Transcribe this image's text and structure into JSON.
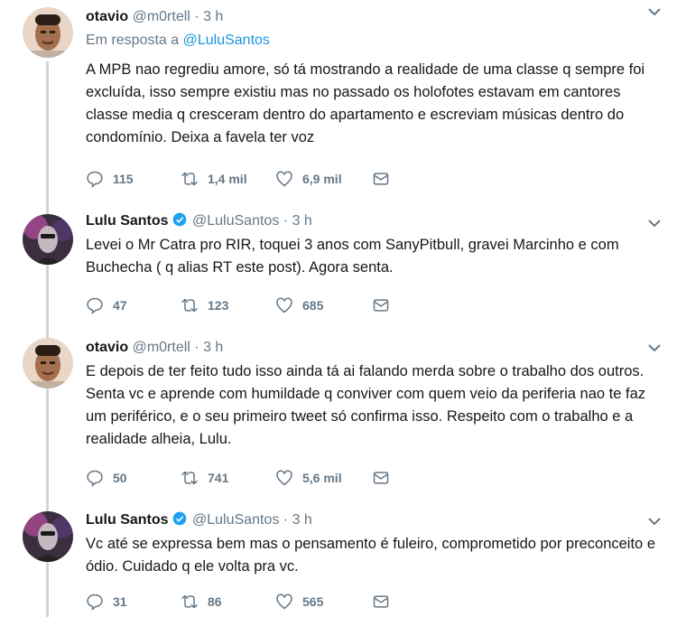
{
  "tweets": [
    {
      "name": "otavio",
      "handle": "@m0rtell",
      "time": "3 h",
      "verified": false,
      "avatar": "avatar-otavio",
      "reply_prefix": "Em resposta a ",
      "reply_mention": "@LuluSantos",
      "text": "A MPB nao regrediu amore, só tá mostrando a realidade de uma classe q sempre foi excluída, isso sempre existiu mas no passado os holofotes estavam em cantores classe media q cresceram dentro do apartamento e escreviam músicas dentro do condomínio. Deixa a favela ter voz",
      "replies": "115",
      "retweets": "1,4 mil",
      "likes": "6,9 mil"
    },
    {
      "name": "Lulu Santos",
      "handle": "@LuluSantos",
      "time": "3 h",
      "verified": true,
      "avatar": "avatar-lulu",
      "text": "Levei o Mr Catra pro RIR, toquei 3 anos com SanyPitbull, gravei Marcinho e com Buchecha ( q alias RT este post). Agora senta.",
      "replies": "47",
      "retweets": "123",
      "likes": "685"
    },
    {
      "name": "otavio",
      "handle": "@m0rtell",
      "time": "3 h",
      "verified": false,
      "avatar": "avatar-otavio",
      "text": "E depois de ter feito tudo isso ainda tá ai falando merda sobre o trabalho dos outros. Senta vc e aprende com humildade q conviver com quem veio da periferia nao te faz um periférico, e o seu primeiro tweet só confirma isso. Respeito com o trabalho e a realidade alheia, Lulu.",
      "replies": "50",
      "retweets": "741",
      "likes": "5,6 mil"
    },
    {
      "name": "Lulu Santos",
      "handle": "@LuluSantos",
      "time": "3 h",
      "verified": true,
      "avatar": "avatar-lulu",
      "text": "Vc até se expressa bem mas o pensamento é fuleiro, comprometido por preconceito e ódio. Cuidado q ele volta pra vc.",
      "replies": "31",
      "retweets": "86",
      "likes": "565"
    }
  ],
  "separator": "·",
  "colors": {
    "text": "#14171a",
    "muted": "#657786",
    "link": "#1b95e0",
    "verified": "#1da1f2",
    "thread_line": "#ccd6dd"
  }
}
